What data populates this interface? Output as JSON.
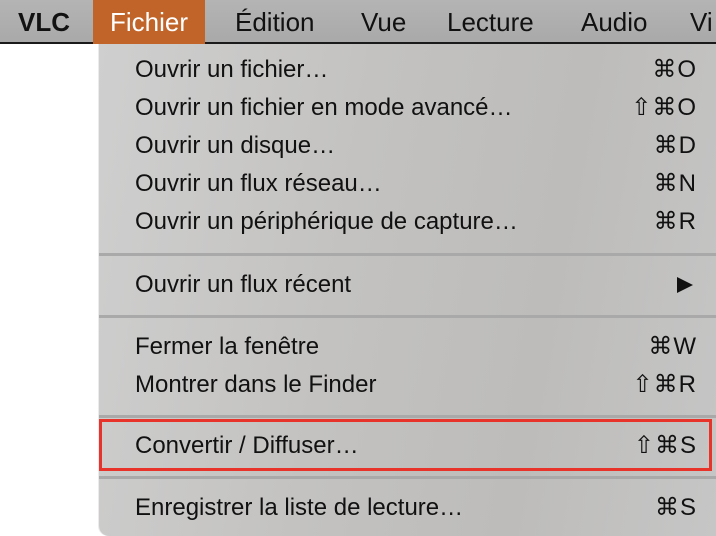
{
  "menubar": {
    "items": [
      {
        "label": "VLC"
      },
      {
        "label": "Fichier"
      },
      {
        "label": "Édition"
      },
      {
        "label": "Vue"
      },
      {
        "label": "Lecture"
      },
      {
        "label": "Audio"
      },
      {
        "label": "Vi"
      }
    ],
    "active_item": "Fichier",
    "active_color": "#c1642a"
  },
  "menu": {
    "items": [
      {
        "label": "Ouvrir un fichier…",
        "shortcut": "⌘O"
      },
      {
        "label": "Ouvrir un fichier en mode avancé…",
        "shortcut": "⇧⌘O"
      },
      {
        "label": "Ouvrir un disque…",
        "shortcut": "⌘D"
      },
      {
        "label": "Ouvrir un flux réseau…",
        "shortcut": "⌘N"
      },
      {
        "label": "Ouvrir un périphérique de capture…",
        "shortcut": "⌘R"
      },
      {
        "label": "Ouvrir un flux récent",
        "submenu_icon": "triangle-right"
      },
      {
        "label": "Fermer la fenêtre",
        "shortcut": "⌘W"
      },
      {
        "label": "Montrer dans le Finder",
        "shortcut": "⇧⌘R"
      },
      {
        "label": "Convertir / Diffuser…",
        "shortcut": "⇧⌘S",
        "highlighted": true
      },
      {
        "label": "Enregistrer la liste de lecture…",
        "shortcut": "⌘S"
      }
    ],
    "highlight_color": "#e8332a"
  }
}
